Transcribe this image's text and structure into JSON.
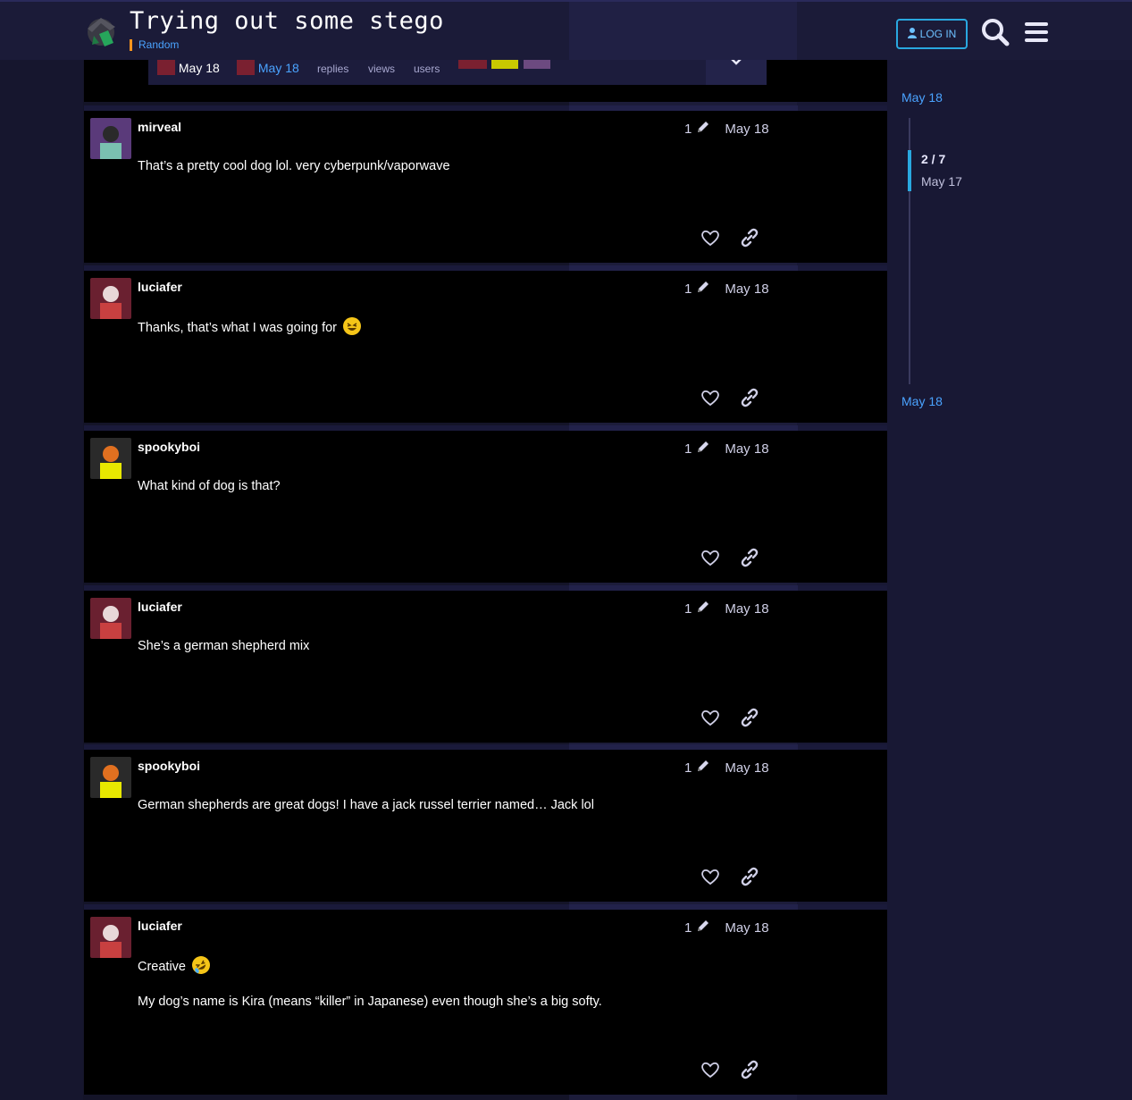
{
  "header": {
    "title": "Trying out some stego",
    "category": "Random",
    "login_label": "LOG IN",
    "logo_icon": "site-logo",
    "search_icon": "search-icon",
    "menu_icon": "hamburger-menu-icon"
  },
  "topic_map": {
    "created_date": "May 18",
    "last_reply_date": "May 18",
    "replies_label": "replies",
    "views_label": "views",
    "users_label": "users"
  },
  "posts": [
    {
      "username": "mirveal",
      "edits": "1",
      "date": "May 18",
      "body": [
        "That’s a pretty cool dog lol. very cyberpunk/vaporwave"
      ]
    },
    {
      "username": "luciafer",
      "edits": "1",
      "date": "May 18",
      "body": [
        "Thanks, that’s what I was going for"
      ]
    },
    {
      "username": "spookyboi",
      "edits": "1",
      "date": "May 18",
      "body": [
        "What kind of dog is that?"
      ]
    },
    {
      "username": "luciafer",
      "edits": "1",
      "date": "May 18",
      "body": [
        "She’s a german shepherd mix"
      ]
    },
    {
      "username": "spookyboi",
      "edits": "1",
      "date": "May 18",
      "body": [
        "German shepherds are great dogs! I have a jack russel terrier named… Jack lol"
      ]
    },
    {
      "username": "luciafer",
      "edits": "1",
      "date": "May 18",
      "body": [
        "Creative",
        "My dog’s name is Kira (means “killer” in Japanese) even though she’s a big softy."
      ]
    }
  ],
  "timeline": {
    "top_date": "May 18",
    "position": "2 / 7",
    "position_date": "May 17",
    "bottom_date": "May 18"
  },
  "colors": {
    "accent": "#29a8e0",
    "link": "#4aa3ff",
    "category_bar": "#f7941d",
    "post_bg": "#000000",
    "page_bg": "#141428"
  }
}
